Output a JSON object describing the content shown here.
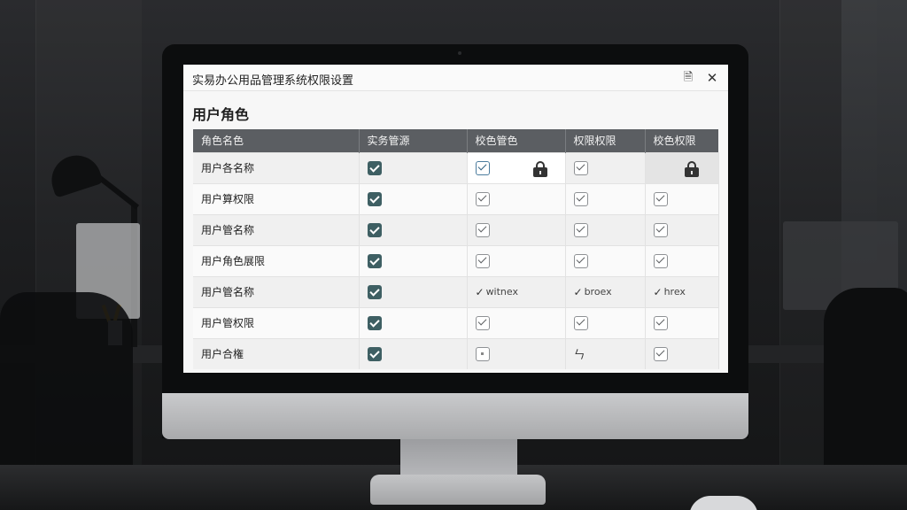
{
  "window": {
    "title": "实易办公用品管理系统权限设置"
  },
  "section": {
    "title": "用户角色"
  },
  "table": {
    "headers": [
      "角色名色",
      "实务管源",
      "校色管色",
      "权限权限",
      "校色权限"
    ],
    "rows": [
      {
        "name": "用户各名称",
        "c1": "checked",
        "c2": "checked-outline",
        "c2_lock": true,
        "c3": "checked-outline",
        "c4_lock": true
      },
      {
        "name": "用户算权限",
        "c1": "checked",
        "c2": "checked-outline",
        "c3": "checked-outline",
        "c4": "checked-outline"
      },
      {
        "name": "用户管名称",
        "c1": "checked",
        "c2": "checked-outline",
        "c3": "checked-outline",
        "c4": "checked-outline"
      },
      {
        "name": "用户角色展限",
        "c1": "checked",
        "c2": "checked-outline",
        "c3": "checked-outline",
        "c4": "checked-outline"
      },
      {
        "name": "用户管名称",
        "c1": "checked",
        "c2_text": "witnex",
        "c3_text": "broex",
        "c4_text": "hrex"
      },
      {
        "name": "用户管权限",
        "c1": "checked",
        "c2": "checked-outline",
        "c3": "checked-outline",
        "c4": "checked-outline"
      },
      {
        "name": "用户合権",
        "c1": "checked",
        "c2": "empty",
        "c3_glyph": "ㄣ",
        "c4": "checked-outline"
      }
    ]
  },
  "icons": {
    "document": "document-icon",
    "close": "close-icon",
    "lock": "lock-icon"
  },
  "colors": {
    "header_bg": "#5b5e62",
    "checkbox_solid": "#3e5f63"
  }
}
